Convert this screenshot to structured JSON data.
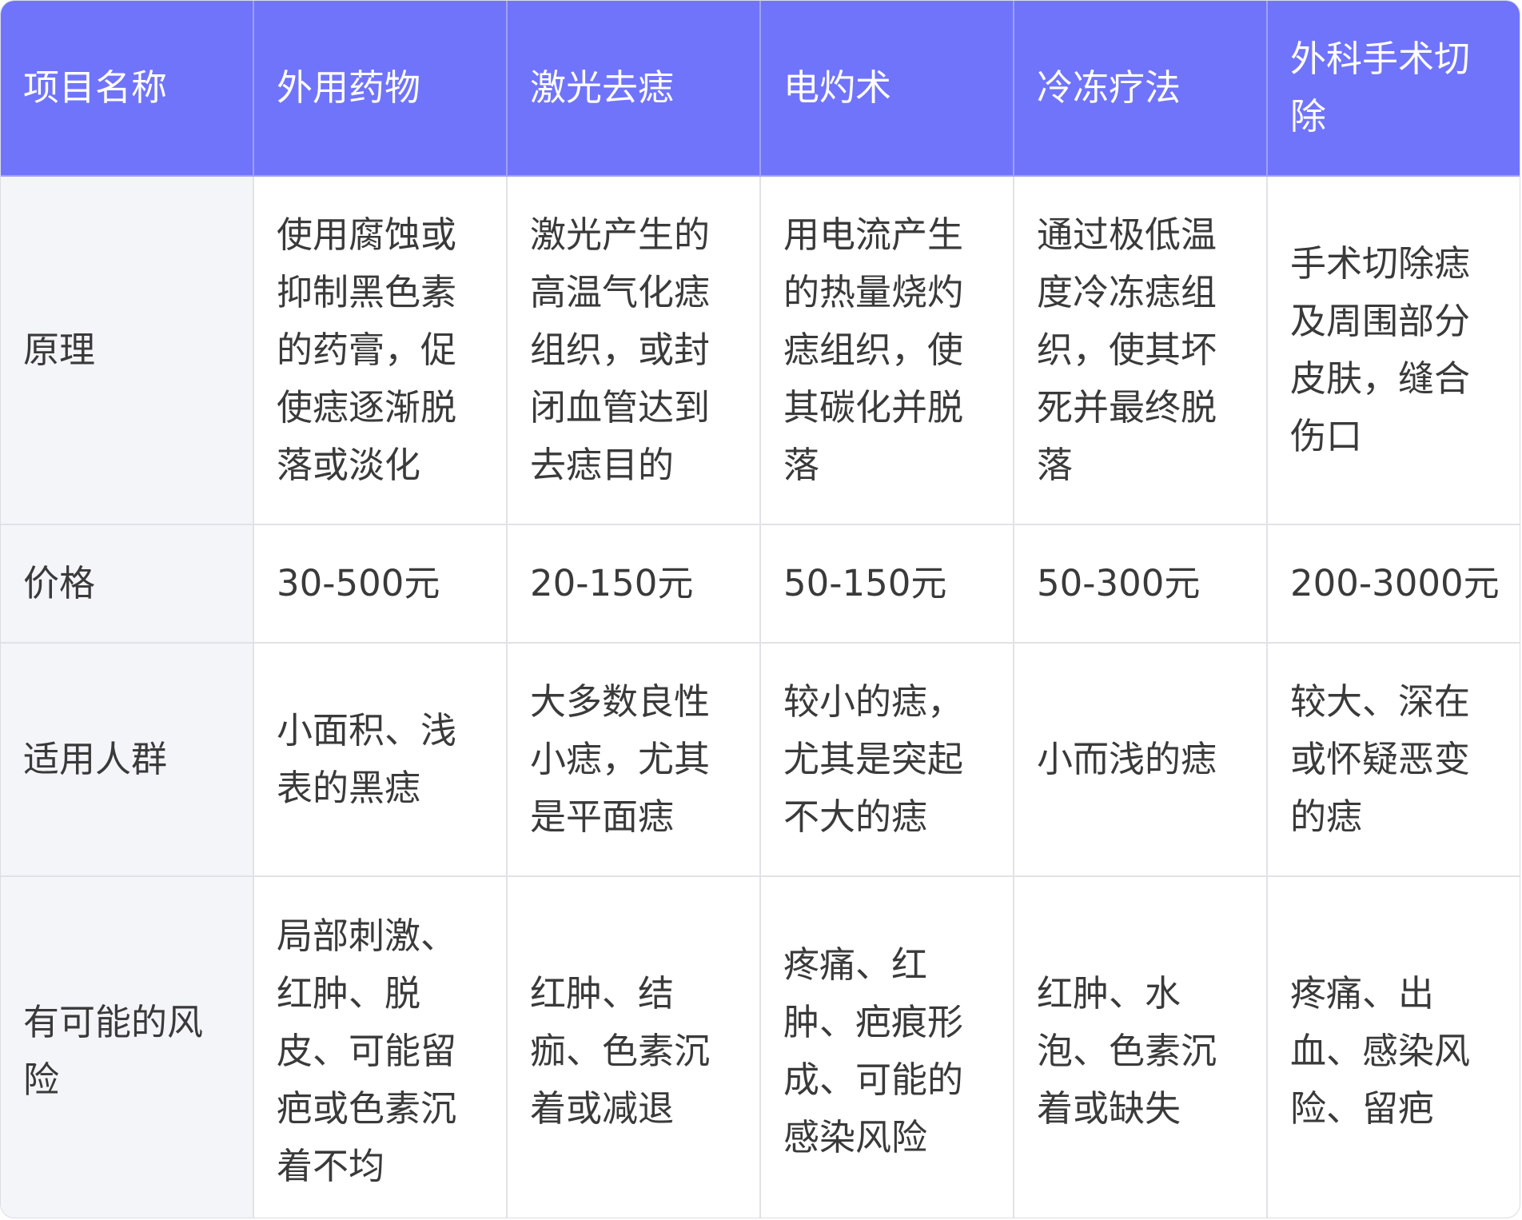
{
  "table": {
    "headers": [
      "项目名称",
      "外用药物",
      "激光去痣",
      "电灼术",
      "冷冻疗法",
      "外科手术切除"
    ],
    "rows": [
      {
        "label": "原理",
        "cells": [
          "使用腐蚀或抑制黑色素的药膏，促使痣逐渐脱落或淡化",
          "激光产生的高温气化痣组织，或封闭血管达到去痣目的",
          "用电流产生的热量烧灼痣组织，使其碳化并脱落",
          "通过极低温度冷冻痣组织，使其坏死并最终脱落",
          "手术切除痣及周围部分皮肤，缝合伤口"
        ]
      },
      {
        "label": "价格",
        "cells": [
          "30-500元",
          "20-150元",
          "50-150元",
          "50-300元",
          "200-3000元"
        ]
      },
      {
        "label": "适用人群",
        "cells": [
          "小面积、浅表的黑痣",
          "大多数良性小痣，尤其是平面痣",
          "较小的痣，尤其是突起不大的痣",
          "小而浅的痣",
          "较大、深在或怀疑恶变的痣"
        ]
      },
      {
        "label": "有可能的风险",
        "cells": [
          "局部刺激、红肿、脱皮、可能留疤或色素沉着不均",
          "红肿、结痂、色素沉着或减退",
          "疼痛、红肿、疤痕形成、可能的感染风险",
          "红肿、水泡、色素沉着或缺失",
          "疼痛、出血、感染风险、留疤"
        ]
      }
    ]
  },
  "colors": {
    "header_bg": "#7074fb",
    "header_text": "#ffffff",
    "label_bg": "#f4f5f9",
    "border": "#e1e2e8",
    "text": "#3a3a3a"
  }
}
